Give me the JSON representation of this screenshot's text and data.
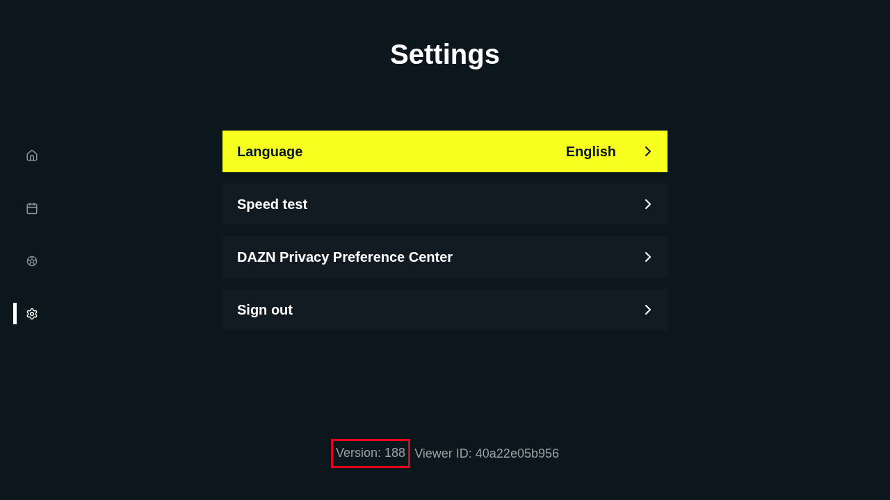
{
  "sidebar": {
    "items": [
      {
        "selected": false
      },
      {
        "selected": false
      },
      {
        "selected": false
      },
      {
        "selected": true
      }
    ]
  },
  "title": "Settings",
  "menu": [
    {
      "label": "Language",
      "value": "English",
      "selected": true
    },
    {
      "label": "Speed test",
      "selected": false
    },
    {
      "label": "DAZN Privacy Preference Center",
      "selected": false
    },
    {
      "label": "Sign out",
      "selected": false
    }
  ],
  "footer": [
    {
      "text": "Version: 188",
      "highlighted": true
    },
    {
      "text": "Viewer ID: 40a22e05b956",
      "highlighted": false
    }
  ]
}
